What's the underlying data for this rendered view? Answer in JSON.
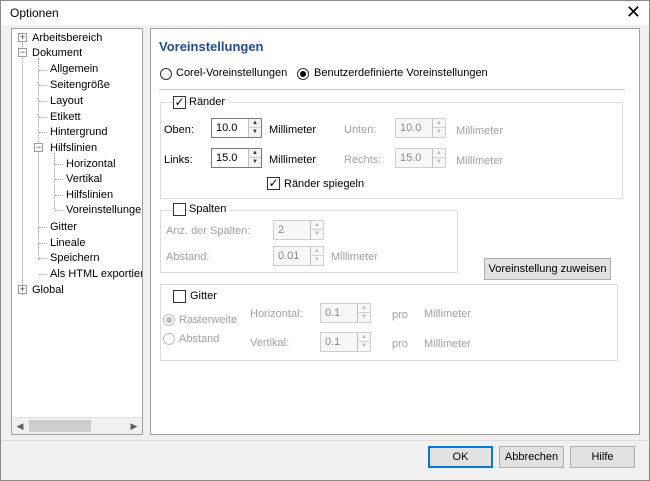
{
  "window": {
    "title": "Optionen"
  },
  "tree": {
    "items": [
      {
        "label": "Arbeitsbereich",
        "level": 0,
        "expander": "+"
      },
      {
        "label": "Dokument",
        "level": 0,
        "expander": "-"
      },
      {
        "label": "Allgemein",
        "level": 1
      },
      {
        "label": "Seitengröße",
        "level": 1
      },
      {
        "label": "Layout",
        "level": 1
      },
      {
        "label": "Etikett",
        "level": 1
      },
      {
        "label": "Hintergrund",
        "level": 1
      },
      {
        "label": "Hilfslinien",
        "level": 1,
        "expander": "-"
      },
      {
        "label": "Horizontal",
        "level": 2
      },
      {
        "label": "Vertikal",
        "level": 2
      },
      {
        "label": "Hilfslinien",
        "level": 2
      },
      {
        "label": "Voreinstellungen",
        "level": 2,
        "selected": true
      },
      {
        "label": "Gitter",
        "level": 1
      },
      {
        "label": "Lineale",
        "level": 1
      },
      {
        "label": "Speichern",
        "level": 1
      },
      {
        "label": "Als HTML exportieren",
        "level": 1
      },
      {
        "label": "Global",
        "level": 0,
        "expander": "+"
      }
    ]
  },
  "panel": {
    "heading": "Voreinstellungen",
    "radio_corel": "Corel-Voreinstellungen",
    "radio_custom": "Benutzerdefinierte Voreinstellungen",
    "raender": {
      "label": "Ränder",
      "checked": true,
      "oben_label": "Oben:",
      "oben_value": "10.0",
      "links_label": "Links:",
      "links_value": "15.0",
      "unit": "Millimeter",
      "unten_label": "Unten:",
      "unten_value": "10.0",
      "rechts_label": "Rechts:",
      "rechts_value": "15.0",
      "mirror_label": "Ränder spiegeln",
      "mirror_checked": true
    },
    "spalten": {
      "label": "Spalten",
      "checked": false,
      "anz_label": "Anz. der Spalten:",
      "anz_value": "2",
      "abstand_label": "Abstand:",
      "abstand_value": "0.01",
      "unit": "Millimeter"
    },
    "assign_button": "Voreinstellung zuweisen",
    "gitter": {
      "label": "Gitter",
      "checked": false,
      "rasterweite": "Rasterweite",
      "abstand": "Abstand",
      "horizontal_label": "Horizontal:",
      "horizontal_value": "0.1",
      "vertikal_label": "Vertikal:",
      "vertikal_value": "0.1",
      "pro": "pro",
      "unit": "Millimeter"
    }
  },
  "buttons": {
    "ok": "OK",
    "cancel": "Abbrechen",
    "help": "Hilfe"
  },
  "colors": {
    "heading": "#1e4e8c",
    "default_button_border": "#0078d7"
  }
}
